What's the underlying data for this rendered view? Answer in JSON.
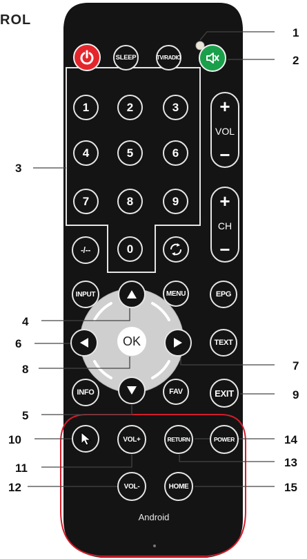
{
  "heading": "ROL",
  "buttons": {
    "sleep": "SLEEP",
    "tv_radio": "TV/RADIO",
    "numbers": [
      "1",
      "2",
      "3",
      "4",
      "5",
      "6",
      "7",
      "8",
      "9",
      "0"
    ],
    "dash": "-/--",
    "vol_label": "VOL",
    "ch_label": "CH",
    "plus": "+",
    "minus": "−",
    "input": "INPUT",
    "menu": "MENU",
    "epg": "EPG",
    "ok": "OK",
    "text": "TEXT",
    "info": "INFO",
    "fav": "FAV",
    "exit": "EXIT",
    "vol_plus": "VOL+",
    "vol_minus": "VOL-",
    "return": "RETURN",
    "power_btn": "POWER",
    "home": "HOME"
  },
  "brand": "Android",
  "callouts": [
    "1",
    "2",
    "3",
    "4",
    "5",
    "6",
    "7",
    "8",
    "9",
    "10",
    "11",
    "12",
    "13",
    "14",
    "15"
  ],
  "colors": {
    "body": "#141414",
    "power_red": "#e4262c",
    "mute_green": "#1aa04a",
    "dpad_ring": "#d0d0d0",
    "android_zone_outline": "#d11d2b"
  },
  "icons": {
    "power": "power-icon",
    "mute": "mute-icon",
    "loop": "loop-icon",
    "up": "arrow-up-icon",
    "down": "arrow-down-icon",
    "left": "arrow-left-icon",
    "right": "arrow-right-icon",
    "mouse": "mouse-pointer-icon"
  }
}
